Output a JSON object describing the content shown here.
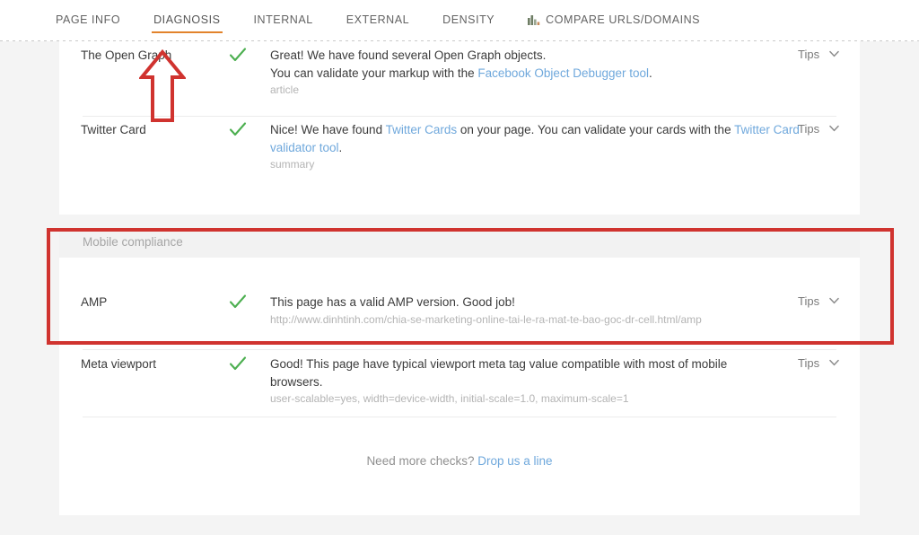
{
  "tabs": [
    {
      "label": "PAGE INFO",
      "active": false,
      "icon": null
    },
    {
      "label": "DIAGNOSIS",
      "active": true,
      "icon": null
    },
    {
      "label": "INTERNAL",
      "active": false,
      "icon": null
    },
    {
      "label": "EXTERNAL",
      "active": false,
      "icon": null
    },
    {
      "label": "DENSITY",
      "active": false,
      "icon": null
    },
    {
      "label": "COMPARE URLS/DOMAINS",
      "active": false,
      "icon": "bar-chart-icon"
    }
  ],
  "tab_labels": {
    "page_info": "PAGE INFO",
    "diagnosis": "DIAGNOSIS",
    "internal": "INTERNAL",
    "external": "EXTERNAL",
    "density": "DENSITY",
    "compare": "COMPARE URLS/DOMAINS"
  },
  "rows": {
    "open_graph": {
      "name": "The Open Graph",
      "status": "pass",
      "status_icon": "green-check-icon",
      "text_1": "Great! We have found several Open Graph objects.",
      "text_2_pre": "You can validate your markup with the ",
      "text_2_link": "Facebook Object Debugger tool",
      "text_2_post": ".",
      "sub": "article",
      "tips": "Tips"
    },
    "twitter_card": {
      "name": "Twitter Card",
      "status": "pass",
      "status_icon": "green-check-icon",
      "text_pre": "Nice! We have found ",
      "link_1": "Twitter Cards",
      "text_mid": " on your page. You can validate your cards with the ",
      "link_2": "Twitter Card validator tool",
      "text_post": ".",
      "sub": "summary",
      "tips": "Tips"
    },
    "amp": {
      "name": "AMP",
      "status": "pass",
      "status_icon": "green-check-icon",
      "text": "This page has a valid AMP version. Good job!",
      "sub": "http://www.dinhtinh.com/chia-se-marketing-online-tai-le-ra-mat-te-bao-goc-dr-cell.html/amp",
      "tips": "Tips"
    },
    "meta_viewport": {
      "name": "Meta viewport",
      "status": "pass",
      "status_icon": "green-check-icon",
      "text": "Good! This page have typical viewport meta tag value compatible with most of mobile browsers.",
      "sub": "user-scalable=yes, width=device-width, initial-scale=1.0, maximum-scale=1",
      "tips": "Tips"
    }
  },
  "sections": {
    "mobile_compliance": "Mobile compliance"
  },
  "footer": {
    "text": "Need more checks? ",
    "link": "Drop us a line"
  },
  "annotations": {
    "highlight_rect": {
      "name": "red-highlight-rectangle",
      "color": "#d0332f"
    },
    "arrow": {
      "name": "red-up-arrow",
      "color": "#d0332f",
      "points_to": "DIAGNOSIS"
    }
  },
  "colors": {
    "accent": "#e2832c",
    "link": "#6fa8dc",
    "pass": "#4caf50",
    "annotation": "#d0332f",
    "page_bg": "#f4f4f4",
    "card_bg": "#ffffff"
  }
}
